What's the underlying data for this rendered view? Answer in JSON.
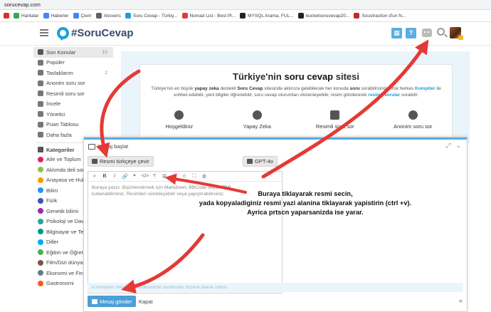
{
  "browser": {
    "url": "sorucevap.com",
    "bookmarks": [
      {
        "label": "",
        "color": "#d93025"
      },
      {
        "label": "Haritalar",
        "color": "#34a853"
      },
      {
        "label": "Haberler",
        "color": "#4285f4"
      },
      {
        "label": "Çevir",
        "color": "#4285f4"
      },
      {
        "label": "Alisveris",
        "color": "#5f6368"
      },
      {
        "label": "Soru Cevap - Türkiy...",
        "color": "#1aa0d8"
      },
      {
        "label": "Nomad List - Best Pl...",
        "color": "#e53935"
      },
      {
        "label": "MYSQL Arama, FUL...",
        "color": "#222222"
      },
      {
        "label": "bucketsorucevap20...",
        "color": "#222222"
      },
      {
        "label": "Soustraction d'un N...",
        "color": "#c62828"
      }
    ]
  },
  "header": {
    "logo": "#SoruCevap",
    "buttons": [
      "grid-icon",
      "help-icon",
      "robot-icon",
      "search-icon",
      "avatar"
    ]
  },
  "sidebar": {
    "items": [
      {
        "label": "Son Konular",
        "count": "10",
        "icon": "chat-icon",
        "active": true,
        "color": "#555555"
      },
      {
        "label": "Popüler",
        "count": "",
        "icon": "popular-icon",
        "color": "#777777"
      },
      {
        "label": "Taslaklarım",
        "count": "2",
        "icon": "draft-icon",
        "color": "#777777"
      },
      {
        "label": "Anonim soru sor",
        "count": "",
        "icon": "anon-icon",
        "color": "#777777"
      },
      {
        "label": "Resimli soru sor",
        "count": "",
        "icon": "image-icon",
        "color": "#777777"
      },
      {
        "label": "İncele",
        "count": "",
        "icon": "review-icon",
        "color": "#777777"
      },
      {
        "label": "Yönetici",
        "count": "",
        "icon": "admin-icon",
        "color": "#777777"
      },
      {
        "label": "Puan Tablosu",
        "count": "",
        "icon": "trophy-icon",
        "color": "#777777"
      },
      {
        "label": "Daha fazla",
        "count": "",
        "icon": "more-icon",
        "color": "#777777"
      }
    ],
    "categories_title": "Kategoriler",
    "categories": [
      {
        "label": "Aile ve Toplum",
        "color": "#e91e63"
      },
      {
        "label": "Aklımda deli sor",
        "color": "#8bc34a"
      },
      {
        "label": "Anayasa ve Huk",
        "color": "#ff9800"
      },
      {
        "label": "Bilim",
        "color": "#2196f3"
      },
      {
        "label": "Fizik",
        "color": "#3f51b5"
      },
      {
        "label": "Genetik bilimi",
        "color": "#9c27b0"
      },
      {
        "label": "Psikoloji ve Dav",
        "color": "#26a69a"
      },
      {
        "label": "Bilgisayar ve Teknolo",
        "color": "#009688"
      },
      {
        "label": "Diller",
        "color": "#03a9f4"
      },
      {
        "label": "Eğitim ve Öğreti",
        "color": "#4caf50"
      },
      {
        "label": "Film/Dizi dünyas",
        "color": "#795548"
      },
      {
        "label": "Ekonomi ve Fina",
        "color": "#607d8b"
      },
      {
        "label": "Gastronomi",
        "color": "#ff5722"
      }
    ]
  },
  "hero": {
    "title_prefix": "Türkiye'nin ",
    "title_bold": "soru cevap",
    "title_suffix": " sitesi",
    "desc_1": "Türkiye'nin en büyük ",
    "desc_b1": "yapay zeka",
    "desc_2": " destekli ",
    "desc_b2": "Soru Cevap",
    "desc_3": " sitesinde aklınıza gelebilecek her konuda ",
    "desc_b3": "soru",
    "desc_4": " sorabilirsiniz. Artık herkes ",
    "desc_l1": "Kompiter",
    "desc_5": " ile sohbet edebilir, yeni bilgiler öğrenebilir, soru cevap oturumları düzenleyebilir, resim göndererek ",
    "desc_l2": "resimli sorular",
    "desc_6": " sorabilir.",
    "features": [
      {
        "label": "Hoşgeldiniz",
        "icon": "info-icon"
      },
      {
        "label": "Yapay Zeka",
        "icon": "brain-icon"
      },
      {
        "label": "Resimli soru sor",
        "icon": "image-icon"
      },
      {
        "label": "Anonim soru sor",
        "icon": "info-icon"
      }
    ]
  },
  "composer": {
    "title": "Mesaj başlat",
    "translate_button": "Resmi türkçeye çevir",
    "model_button": "GPT-4o",
    "toolbar": [
      "⌕",
      "B",
      "I",
      "🔗",
      "❞",
      "</>",
      "⤒",
      "☰",
      "≡",
      "☺",
      "⛶",
      "⚙"
    ],
    "placeholder_1": "Buraya yazın. Biçimlendirmek için Markdown, BBCode veya HTML",
    "placeholder_2": "kullanabilirsiniz. Resimleri sürükleyebilir veya yapıştırabilirsiniz.",
    "footer_note": "Ai kompiter mesajları moderatörler tarafından düzenli olarak izlenir.",
    "send_button": "Mesaj gönder",
    "close_link": "Kapat"
  },
  "annotation": {
    "line1": "Buraya tiklayarak resmi secin,",
    "line2": "yada kopyaladiginiz resmi yazi alanina tiklayarak yapistirin (ctrl +v).",
    "line3": "Ayrica prtscn yaparsanizda ise yarar.",
    "arrow_color": "#e53935"
  }
}
